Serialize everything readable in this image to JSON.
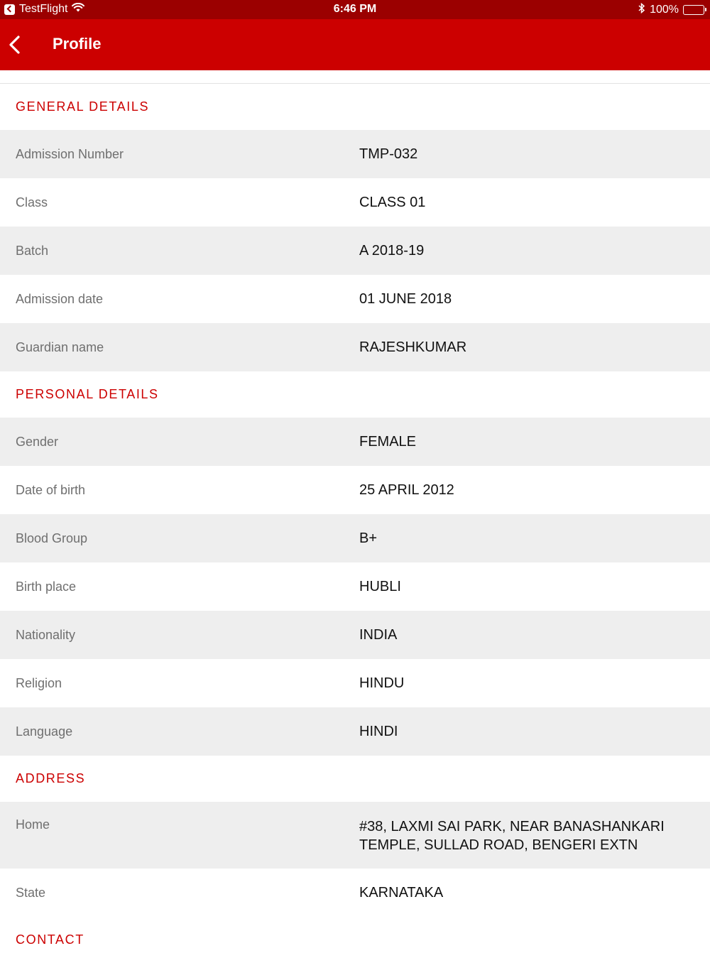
{
  "status_bar": {
    "app": "TestFlight",
    "time": "6:46 PM",
    "battery": "100%"
  },
  "header": {
    "title": "Profile"
  },
  "sections": {
    "general": {
      "title": "GENERAL DETAILS",
      "rows": [
        {
          "label": "Admission Number",
          "value": "TMP-032"
        },
        {
          "label": "Class",
          "value": "CLASS 01"
        },
        {
          "label": "Batch",
          "value": "A 2018-19"
        },
        {
          "label": "Admission date",
          "value": "01 JUNE 2018"
        },
        {
          "label": "Guardian name",
          "value": "RAJESHKUMAR"
        }
      ]
    },
    "personal": {
      "title": "PERSONAL DETAILS",
      "rows": [
        {
          "label": "Gender",
          "value": "FEMALE"
        },
        {
          "label": "Date of birth",
          "value": "25 APRIL 2012"
        },
        {
          "label": "Blood Group",
          "value": "B+"
        },
        {
          "label": "Birth place",
          "value": "HUBLI"
        },
        {
          "label": "Nationality",
          "value": "INDIA"
        },
        {
          "label": "Religion",
          "value": "HINDU"
        },
        {
          "label": "Language",
          "value": "HINDI"
        }
      ]
    },
    "address": {
      "title": "ADDRESS",
      "rows": [
        {
          "label": "Home",
          "value_line1": "#38, LAXMI SAI PARK, NEAR BANASHANKARI",
          "value_line2": "TEMPLE, SULLAD ROAD, BENGERI EXTN"
        },
        {
          "label": "State",
          "value": "KARNATAKA"
        }
      ]
    },
    "contact": {
      "title": "CONTACT"
    }
  },
  "colors": {
    "status_bar": "#9b0000",
    "nav_bar": "#cc0000",
    "accent": "#cc0000",
    "row_alt": "#eeeeee"
  },
  "icons": {
    "back": "chevron-left-icon",
    "wifi": "wifi-icon",
    "bluetooth": "bluetooth-icon",
    "battery": "battery-icon"
  }
}
